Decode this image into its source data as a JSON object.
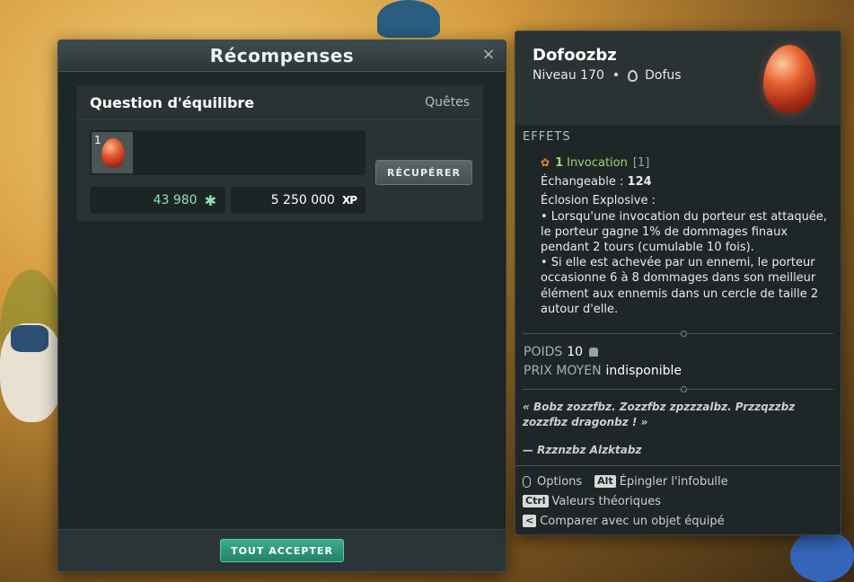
{
  "rewards_window": {
    "title": "Récompenses",
    "close_label": "×",
    "quest": {
      "title": "Question d'équilibre",
      "type": "Quêtes",
      "item_quantity": "1",
      "collect_button": "RÉCUPÉRER",
      "kamas": "43 980",
      "kamas_icon": "✱",
      "xp": "5 250 000",
      "xp_icon": "XP"
    },
    "accept_all_button": "TOUT ACCEPTER"
  },
  "tooltip": {
    "name": "Dofoozbz",
    "level": "Niveau 170",
    "separator": "•",
    "category": "Dofus",
    "section_effects": "EFFETS",
    "invocation_count": "1",
    "invocation_label": "Invocation",
    "invocation_bracket": "[1]",
    "exchangeable_label": "Échangeable :",
    "exchangeable_value": "124",
    "effect_title": "Éclosion Explosive :",
    "effect_line1": "• Lorsqu'une invocation du porteur est attaquée, le porteur gagne 1% de dommages finaux pendant 2 tours (cumulable 10 fois).",
    "effect_line2": "• Si elle est achevée par un ennemi, le porteur occasionne 6 à 8 dommages dans son meilleur élément aux ennemis dans un cercle de taille 2 autour d'elle.",
    "weight_label": "POIDS",
    "weight_value": "10",
    "price_label": "PRIX MOYEN",
    "price_value": "indisponible",
    "quote": "« Bobz zozzfbz. Zozzfbz zpzzzalbz. Przzqzzbz zozzfbz dragonbz ! »",
    "author": "— Rzznzbz Alzktabz",
    "footer": {
      "options": "Options",
      "alt_key": "Alt",
      "pin": "Épingler l'infobulle",
      "ctrl_key": "Ctrl",
      "theoretical": "Valeurs théoriques",
      "compare_key": "<",
      "compare": "Comparer avec un objet équipé"
    }
  },
  "colors": {
    "panel_bg": "#1f2627",
    "accent_green": "#2f9c7c",
    "kamas_color": "#8fe0b8",
    "invocation_color": "#9bd36a"
  }
}
